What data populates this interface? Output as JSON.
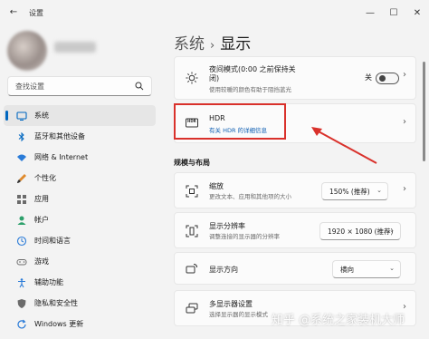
{
  "window": {
    "app_title": "设置",
    "back_glyph": "←",
    "minimize_glyph": "—",
    "maximize_glyph": "☐",
    "close_glyph": "✕"
  },
  "sidebar": {
    "search_placeholder": "查找设置",
    "items": [
      {
        "label": "系统",
        "icon": "monitor-icon",
        "active": true
      },
      {
        "label": "蓝牙和其他设备",
        "icon": "bluetooth-icon"
      },
      {
        "label": "网络 & Internet",
        "icon": "wifi-icon"
      },
      {
        "label": "个性化",
        "icon": "brush-icon"
      },
      {
        "label": "应用",
        "icon": "apps-icon"
      },
      {
        "label": "帐户",
        "icon": "person-icon"
      },
      {
        "label": "时间和语言",
        "icon": "globe-clock-icon"
      },
      {
        "label": "游戏",
        "icon": "gamepad-icon"
      },
      {
        "label": "辅助功能",
        "icon": "accessibility-icon"
      },
      {
        "label": "隐私和安全性",
        "icon": "shield-icon"
      },
      {
        "label": "Windows 更新",
        "icon": "update-icon"
      }
    ]
  },
  "main": {
    "breadcrumb_parent": "系统",
    "breadcrumb_sep": "›",
    "breadcrumb_current": "显示",
    "night_light": {
      "title": "夜间模式(0:00 之前保持关",
      "title_line2": "闭)",
      "subtitle": "使用较暖的颜色有助于阻挡蓝光",
      "toggle_label": "关",
      "toggle_on": false
    },
    "hdr": {
      "title": "HDR",
      "link": "有关 HDR 的详细信息",
      "icon_text": "HDR"
    },
    "section_title": "规模与布局",
    "scale": {
      "title": "缩放",
      "subtitle": "更改文本、应用和其他项的大小",
      "value": "150% (推荐)"
    },
    "resolution": {
      "title": "显示分辨率",
      "subtitle": "调整连接的显示器的分辨率",
      "value": "1920 × 1080 (推荐)"
    },
    "orientation": {
      "title": "显示方向",
      "value": "横向"
    },
    "multi_display": {
      "title": "多显示器设置",
      "subtitle": "选择显示器的显示模式"
    },
    "chevron": "›",
    "dropdown_arrow": "⌄"
  },
  "watermark": {
    "text": "知乎 @系统之家装机大师"
  },
  "colors": {
    "accent": "#0067c0",
    "highlight_box": "#d9312b",
    "link": "#0f5fb3"
  }
}
